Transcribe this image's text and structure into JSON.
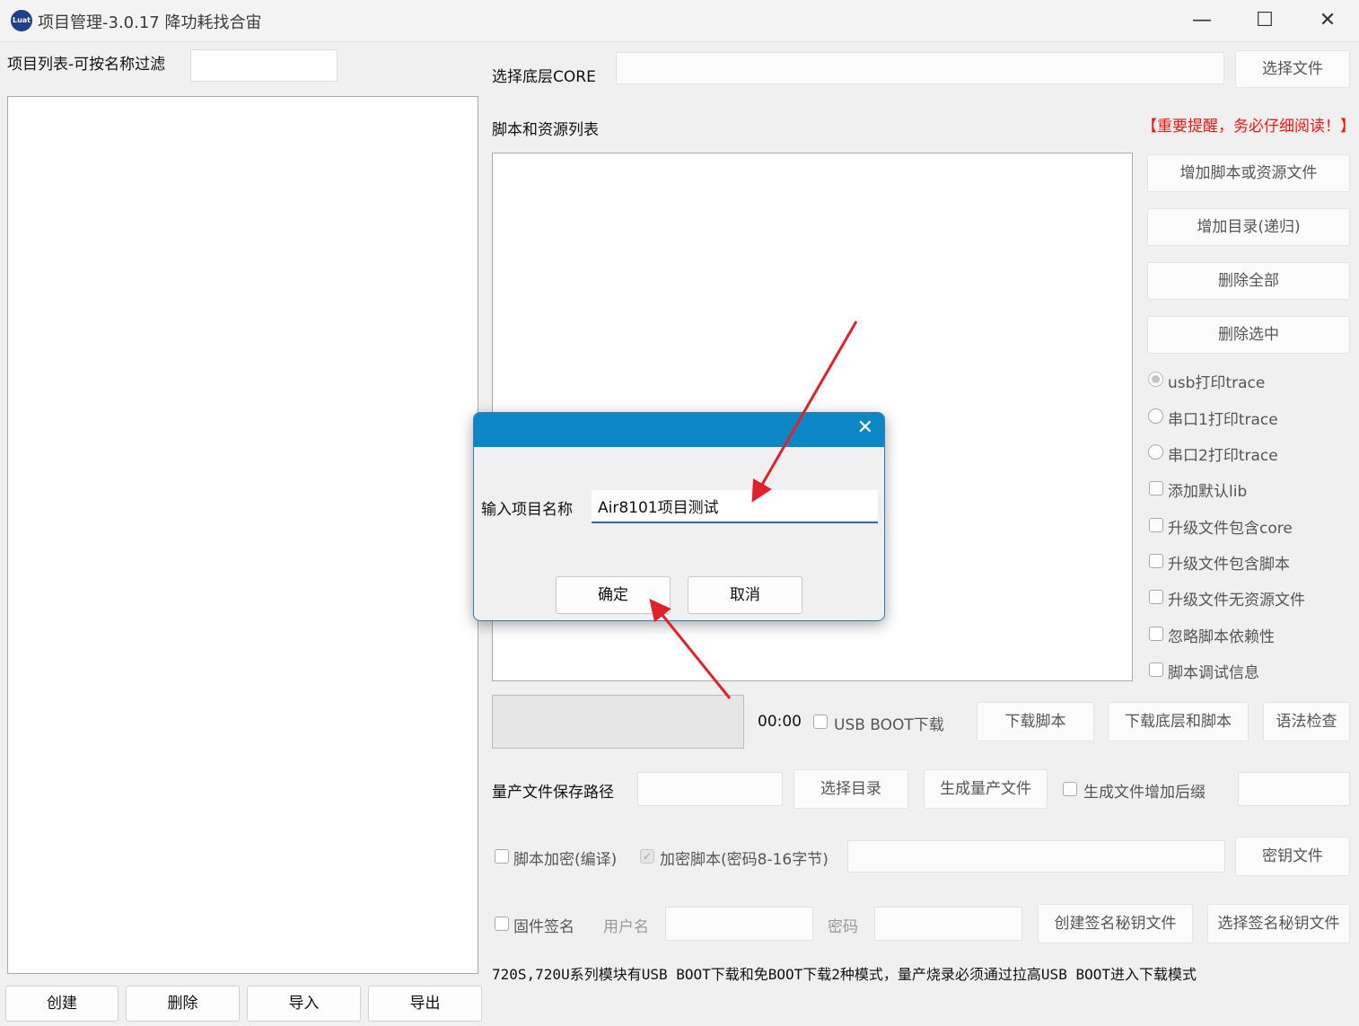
{
  "window": {
    "logo_text": "Luat",
    "title": "项目管理-3.0.17 降功耗找合宙",
    "minimize_symbol": "—",
    "maximize_symbol": "☐",
    "close_symbol": "✕"
  },
  "left": {
    "filter_label": "项目列表-可按名称过滤",
    "filter_value": "",
    "buttons": [
      "创建",
      "删除",
      "导入",
      "导出"
    ]
  },
  "core": {
    "label": "选择底层CORE",
    "value": "",
    "button": "选择文件"
  },
  "scripts": {
    "label": "脚本和资源列表",
    "warning": "【重要提醒，务必仔细阅读！】",
    "buttons": [
      "增加脚本或资源文件",
      "增加目录(递归)",
      "删除全部",
      "删除选中"
    ]
  },
  "trace_options": [
    "usb打印trace",
    "串口1打印trace",
    "串口2打印trace"
  ],
  "check_options": [
    "添加默认lib",
    "升级文件包含core",
    "升级文件包含脚本",
    "升级文件无资源文件",
    "忽略脚本依赖性",
    "脚本调试信息"
  ],
  "download": {
    "timer": "00:00",
    "usb_boot_label": "USB BOOT下载",
    "download_script": "下载脚本",
    "download_core_script": "下载底层和脚本",
    "syntax_check": "语法检查"
  },
  "mass": {
    "label": "量产文件保存路径",
    "select_dir": "选择目录",
    "generate": "生成量产文件",
    "suffix_label": "生成文件增加后缀"
  },
  "encrypt": {
    "script_encrypt": "脚本加密(编译)",
    "encrypt_script": "加密脚本(密码8-16字节)",
    "key_file": "密钥文件"
  },
  "sign": {
    "firmware_sign": "固件签名",
    "username_label": "用户名",
    "password_label": "密码",
    "create_key": "创建签名秘钥文件",
    "select_key": "选择签名秘钥文件"
  },
  "notice": "720S,720U系列模块有USB BOOT下载和免BOOT下载2种模式，量产烧录必须通过拉高USB BOOT进入下载模式",
  "dialog": {
    "close_symbol": "✕",
    "label": "输入项目名称",
    "value": "Air8101项目测试",
    "ok": "确定",
    "cancel": "取消"
  },
  "colors": {
    "dialog_header": "#0a87c4",
    "warning": "#ff1010",
    "arrow": "#e0202a"
  }
}
